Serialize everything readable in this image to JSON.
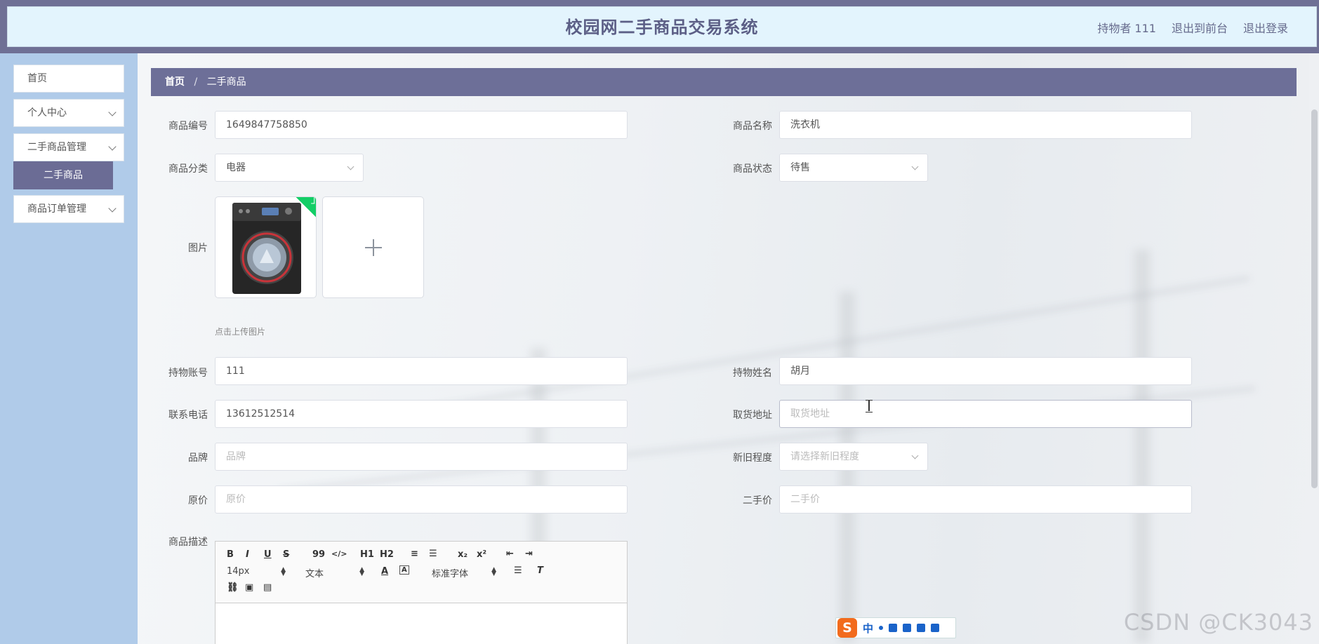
{
  "header": {
    "title": "校园网二手商品交易系统",
    "user_label": "持物者 111",
    "exit_front_label": "退出到前台",
    "logout_label": "退出登录"
  },
  "sidebar": {
    "items": [
      {
        "label": "首页"
      },
      {
        "label": "个人中心"
      },
      {
        "label": "二手商品管理"
      },
      {
        "label": "商品订单管理"
      }
    ],
    "submenu": {
      "label": "二手商品"
    }
  },
  "breadcrumb": {
    "home": "首页",
    "separator": "/",
    "current": "二手商品"
  },
  "form": {
    "product_code": {
      "label": "商品编号",
      "value": "1649847758850"
    },
    "product_name": {
      "label": "商品名称",
      "value": "洗衣机"
    },
    "category": {
      "label": "商品分类",
      "value": "电器"
    },
    "status": {
      "label": "商品状态",
      "value": "待售"
    },
    "image": {
      "label": "图片",
      "tip": "点击上传图片"
    },
    "account": {
      "label": "持物账号",
      "value": "111"
    },
    "owner_name": {
      "label": "持物姓名",
      "value": "胡月"
    },
    "phone": {
      "label": "联系电话",
      "value": "13612512514"
    },
    "pickup_address": {
      "label": "取货地址",
      "placeholder": "取货地址"
    },
    "brand": {
      "label": "品牌",
      "placeholder": "品牌"
    },
    "condition": {
      "label": "新旧程度",
      "placeholder": "请选择新旧程度"
    },
    "original_price": {
      "label": "原价",
      "placeholder": "原价"
    },
    "secondhand_price": {
      "label": "二手价",
      "placeholder": "二手价"
    },
    "description": {
      "label": "商品描述"
    }
  },
  "editor": {
    "toolbar_row1": [
      "B",
      "I",
      "U",
      "S",
      "99",
      "</>",
      "H1",
      "H2",
      "≡",
      "☰",
      "x₂",
      "x²",
      "⇤",
      "⇥"
    ],
    "font_size": "14px",
    "text_type": "文本",
    "font_family": "标准字体",
    "color_a": "A"
  },
  "ime": {
    "logo": "S",
    "mode": "中"
  },
  "watermark": "CSDN @CK3043",
  "colors": {
    "brand": "#6d6f98",
    "header_bg": "#e3f4fd",
    "sidebar_bg": "#b0cbe9",
    "upload_success": "#13ce66"
  }
}
